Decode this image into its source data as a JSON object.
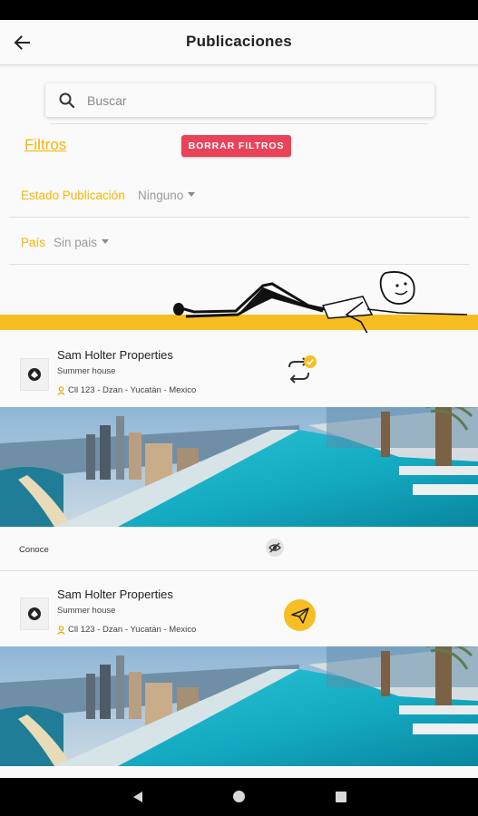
{
  "app_bar": {
    "title": "Publicaciones",
    "back_icon": "arrow-back-icon"
  },
  "search": {
    "placeholder": "Buscar",
    "value": ""
  },
  "filters": {
    "title": "Filtros",
    "clear_label": "BORRAR FILTROS",
    "clear_color": "#e9435a",
    "accent_color": "#f6b500",
    "estado": {
      "label": "Estado Publicación",
      "value": "Ninguno"
    },
    "pais": {
      "label": "País",
      "value": "Sin pais"
    }
  },
  "listings": [
    {
      "owner": "Sam Holter Properties",
      "type": "Summer house",
      "address": "Cll 123 - Dzan - Yucatán - Mexico",
      "action_icon": "sync-check-icon"
    },
    {
      "owner": "Sam Holter Properties",
      "type": "Summer house",
      "address": "Cll 123 - Dzan - Yucatán - Mexico",
      "action_icon": "send-icon"
    }
  ],
  "conoce": {
    "label": "Conoce",
    "icon": "visibility-off-icon"
  }
}
